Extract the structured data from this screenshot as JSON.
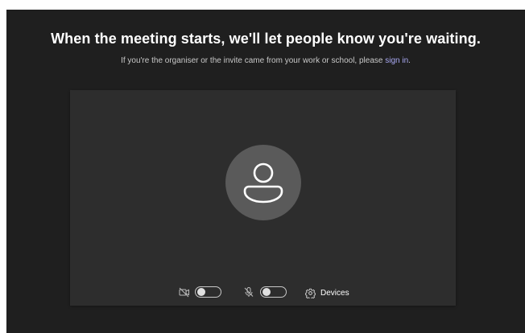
{
  "header": {
    "title": "When the meeting starts, we'll let people know you're waiting.",
    "subtitle_prefix": "If you're the organiser or the invite came from your work or school, please ",
    "sign_in_link": "sign in",
    "subtitle_suffix": "."
  },
  "preview": {
    "avatar_icon": "person-icon",
    "camera": {
      "icon": "camera-off-icon",
      "enabled": false
    },
    "microphone": {
      "icon": "mic-off-icon",
      "enabled": false
    },
    "devices": {
      "icon": "gear-icon",
      "label": "Devices"
    }
  },
  "colors": {
    "background": "#1f1f1f",
    "preview": "#2d2d2d",
    "avatar": "#5a5a5a",
    "link": "#a9a9f3"
  }
}
